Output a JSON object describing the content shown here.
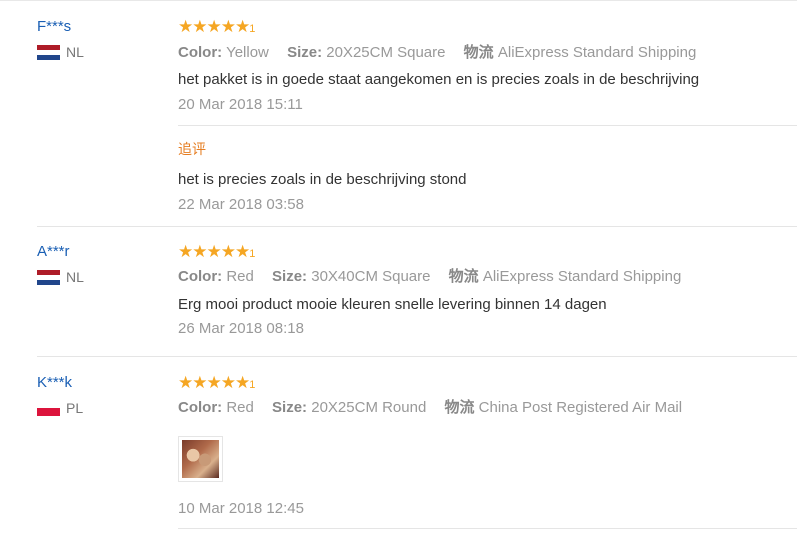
{
  "reviews": [
    {
      "user": "F***s",
      "country": "NL",
      "stars": "★★★★★",
      "stars_tail": "1",
      "color_label": "Color:",
      "color": "Yellow",
      "size_label": "Size:",
      "size": "20X25CM Square",
      "shipping_label": "物流",
      "shipping": "AliExpress Standard Shipping",
      "text": "het pakket is in goede staat aangekomen en is precies zoals in de beschrijving",
      "date": "20 Mar 2018 15:11",
      "followup": {
        "label": "追评",
        "text": "het is precies zoals in de beschrijving stond",
        "date": "22 Mar 2018 03:58"
      }
    },
    {
      "user": "A***r",
      "country": "NL",
      "stars": "★★★★★",
      "stars_tail": "1",
      "color_label": "Color:",
      "color": "Red",
      "size_label": "Size:",
      "size": "30X40CM Square",
      "shipping_label": "物流",
      "shipping": "AliExpress Standard Shipping",
      "text": "Erg mooi product mooie kleuren snelle levering binnen 14 dagen",
      "date": "26 Mar 2018 08:18"
    },
    {
      "user": "K***k",
      "country": "PL",
      "stars": "★★★★★",
      "stars_tail": "1",
      "color_label": "Color:",
      "color": "Red",
      "size_label": "Size:",
      "size": "20X25CM Round",
      "shipping_label": "物流",
      "shipping": "China Post Registered Air Mail",
      "date": "10 Mar 2018 12:45"
    }
  ],
  "colors": {
    "username": "#1a5fb4",
    "stars": "#f5a623",
    "followup": "#e67e22",
    "nl_flag": [
      "#ae1c28",
      "#ffffff",
      "#21468b"
    ],
    "pl_flag": [
      "#ffffff",
      "#dc143c"
    ]
  }
}
